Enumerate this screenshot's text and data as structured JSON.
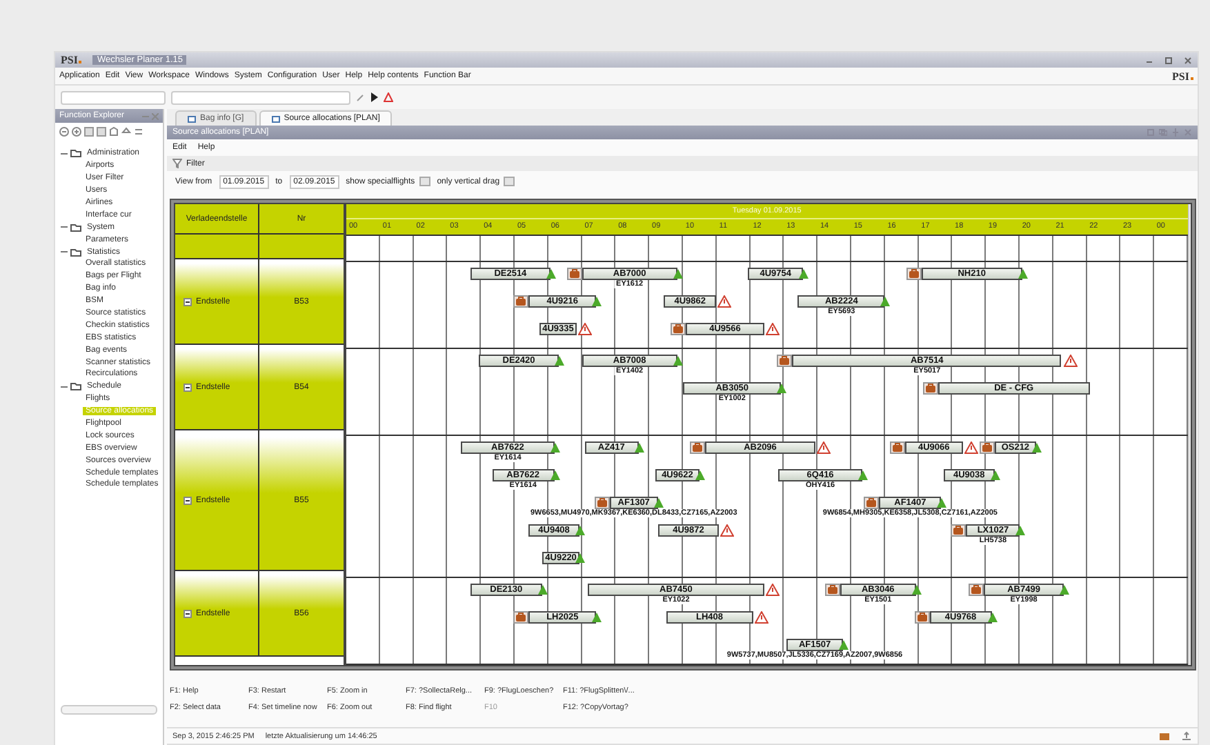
{
  "window": {
    "logo": "PSI",
    "title": "Wechsler Planer 1.15"
  },
  "menu": [
    "Application",
    "Edit",
    "View",
    "Workspace",
    "Windows",
    "System",
    "Configuration",
    "User",
    "Help",
    "Help contents",
    "Function Bar"
  ],
  "brand": "PSI",
  "explorer": {
    "title": "Function Explorer",
    "tree": [
      {
        "label": "Administration",
        "expanded": true,
        "selected": false,
        "children": [
          {
            "label": "Airports",
            "selected": false
          },
          {
            "label": "User Filter",
            "selected": false
          },
          {
            "label": "Users",
            "selected": false
          },
          {
            "label": "Airlines",
            "selected": false
          },
          {
            "label": "Interface cur",
            "selected": false
          }
        ]
      },
      {
        "label": "System",
        "expanded": true,
        "selected": false,
        "children": [
          {
            "label": "Parameters",
            "selected": false
          }
        ]
      },
      {
        "label": "Statistics",
        "expanded": true,
        "selected": false,
        "children": [
          {
            "label": "Overall statistics",
            "selected": false
          },
          {
            "label": "Bags per Flight",
            "selected": false
          },
          {
            "label": "Bag info",
            "selected": false
          },
          {
            "label": "BSM",
            "selected": false
          },
          {
            "label": "Source statistics",
            "selected": false
          },
          {
            "label": "Checkin statistics",
            "selected": false
          },
          {
            "label": "EBS statistics",
            "selected": false
          },
          {
            "label": "Bag events",
            "selected": false
          },
          {
            "label": "Scanner statistics",
            "selected": false
          },
          {
            "label": "Recirculations",
            "selected": false
          }
        ]
      },
      {
        "label": "Schedule",
        "expanded": true,
        "selected": false,
        "children": [
          {
            "label": "Flights",
            "selected": false
          },
          {
            "label": "Source allocations",
            "selected": true
          },
          {
            "label": "Flightpool",
            "selected": false
          },
          {
            "label": "Lock sources",
            "selected": false
          },
          {
            "label": "EBS overview",
            "selected": false
          },
          {
            "label": "Sources overview",
            "selected": false
          },
          {
            "label": "Schedule templates",
            "selected": false
          },
          {
            "label": "Schedule templates",
            "selected": false
          }
        ]
      }
    ]
  },
  "tabs": [
    {
      "label": "Bag info [G]",
      "selected": false
    },
    {
      "label": "Source allocations [PLAN]",
      "selected": true
    }
  ],
  "view": {
    "title": "Source allocations [PLAN]",
    "menu": [
      "Edit",
      "Help"
    ],
    "filter": "Filter",
    "range": {
      "from_label": "View from",
      "from": "01.09.2015",
      "to_label": "to",
      "to": "02.09.2015"
    },
    "options": [
      {
        "label": "show specialflights",
        "checked": false
      },
      {
        "label": "only vertical drag",
        "checked": false
      }
    ]
  },
  "gantt": {
    "columns": [
      "Verladeendstelle",
      "Nr"
    ],
    "date": "Tuesday 01.09.2015",
    "hours": [
      "00",
      "01",
      "02",
      "03",
      "04",
      "05",
      "06",
      "07",
      "08",
      "09",
      "10",
      "11",
      "12",
      "13",
      "14",
      "15",
      "16",
      "17",
      "18",
      "19",
      "20",
      "21",
      "22",
      "23",
      "00"
    ],
    "groups": [
      {
        "label": "Endstelle",
        "nr": "B53",
        "expanded": true,
        "lanes": [
          {
            "bars": [
              {
                "label": "DE2514",
                "bag": false,
                "confirmed": true,
                "warning": false
              },
              {
                "label": "AB7000",
                "bag": true,
                "confirmed": true,
                "warning": false,
                "note": "EY1612"
              },
              {
                "label": "4U9754",
                "bag": false,
                "confirmed": true,
                "warning": false
              },
              {
                "label": "NH210",
                "bag": true,
                "confirmed": true,
                "warning": false
              }
            ]
          },
          {
            "bars": [
              {
                "label": "4U9216",
                "bag": true,
                "confirmed": true,
                "warning": false
              },
              {
                "label": "4U9862",
                "bag": false,
                "confirmed": false,
                "warning": true
              },
              {
                "label": "AB2224",
                "bag": false,
                "confirmed": true,
                "warning": false,
                "note": "EY5693"
              }
            ]
          },
          {
            "bars": [
              {
                "label": "4U9335",
                "bag": false,
                "confirmed": false,
                "warning": true
              },
              {
                "label": "4U9566",
                "bag": true,
                "confirmed": false,
                "warning": true
              }
            ]
          }
        ]
      },
      {
        "label": "Endstelle",
        "nr": "B54",
        "expanded": true,
        "lanes": [
          {
            "bars": [
              {
                "label": "DE2420",
                "bag": false,
                "confirmed": true,
                "warning": false
              },
              {
                "label": "AB7008",
                "bag": false,
                "confirmed": true,
                "warning": false,
                "note": "EY1402"
              },
              {
                "label": "AB7514",
                "bag": true,
                "confirmed": false,
                "warning": true,
                "note": "EY5017"
              }
            ]
          },
          {
            "bars": [
              {
                "label": "AB3050",
                "bag": false,
                "confirmed": true,
                "warning": false,
                "note": "EY1002"
              },
              {
                "label": "DE - CFG",
                "bag": true,
                "confirmed": false,
                "warning": false
              }
            ]
          }
        ]
      },
      {
        "label": "Endstelle",
        "nr": "B55",
        "expanded": true,
        "lanes": [
          {
            "bars": [
              {
                "label": "AB7622",
                "bag": false,
                "confirmed": true,
                "warning": false,
                "note": "EY1614"
              },
              {
                "label": "AZ417",
                "bag": false,
                "confirmed": true,
                "warning": false
              },
              {
                "label": "AB2096",
                "bag": true,
                "confirmed": false,
                "warning": true
              },
              {
                "label": "4U9066",
                "bag": true,
                "confirmed": false,
                "warning": true
              },
              {
                "label": "OS212",
                "bag": true,
                "confirmed": true,
                "warning": false
              }
            ]
          },
          {
            "bars": [
              {
                "label": "AB7622",
                "bag": false,
                "confirmed": true,
                "warning": false,
                "note": "EY1614"
              },
              {
                "label": "4U9622",
                "bag": false,
                "confirmed": true,
                "warning": false
              },
              {
                "label": "6Q416",
                "bag": false,
                "confirmed": true,
                "warning": false,
                "note": "OHY416"
              },
              {
                "label": "4U9038",
                "bag": false,
                "confirmed": true,
                "warning": false
              }
            ]
          },
          {
            "bars": [
              {
                "label": "AF1307",
                "bag": true,
                "confirmed": true,
                "warning": false,
                "note": "9W6653,MU4970,MK9367,KE6360,DL8433,CZ7165,AZ2003"
              },
              {
                "label": "AF1407",
                "bag": true,
                "confirmed": true,
                "warning": false,
                "note": "9W6854,MH9305,KE6358,JL5308,CZ7161,AZ2005"
              }
            ]
          },
          {
            "bars": [
              {
                "label": "4U9408",
                "bag": false,
                "confirmed": true,
                "warning": false
              },
              {
                "label": "4U9872",
                "bag": false,
                "confirmed": false,
                "warning": true
              },
              {
                "label": "LX1027",
                "bag": true,
                "confirmed": true,
                "warning": false,
                "note": "LH5738"
              }
            ]
          },
          {
            "bars": [
              {
                "label": "4U9220",
                "bag": false,
                "confirmed": true,
                "warning": false
              }
            ]
          }
        ]
      },
      {
        "label": "Endstelle",
        "nr": "B56",
        "expanded": true,
        "lanes": [
          {
            "bars": [
              {
                "label": "DE2130",
                "bag": false,
                "confirmed": true,
                "warning": false
              },
              {
                "label": "AB7450",
                "bag": false,
                "confirmed": false,
                "warning": true,
                "note": "EY1022"
              },
              {
                "label": "AB3046",
                "bag": true,
                "confirmed": true,
                "warning": false,
                "note": "EY1501"
              },
              {
                "label": "AB7499",
                "bag": true,
                "confirmed": true,
                "warning": false,
                "note": "EY1998"
              }
            ]
          },
          {
            "bars": [
              {
                "label": "LH2025",
                "bag": true,
                "confirmed": true,
                "warning": false
              },
              {
                "label": "LH408",
                "bag": false,
                "confirmed": false,
                "warning": true
              },
              {
                "label": "4U9768",
                "bag": true,
                "confirmed": true,
                "warning": false
              }
            ]
          },
          {
            "bars": [
              {
                "label": "AF1507",
                "bag": false,
                "confirmed": true,
                "warning": false,
                "note": "9W5737,MU8507,JL5336,CZ7169,AZ2007,9W6856"
              }
            ]
          }
        ]
      }
    ]
  },
  "function_keys": [
    {
      "label": "F1: Help",
      "disabled": false
    },
    {
      "label": "F2: Select data",
      "disabled": false
    },
    {
      "label": "F3: Restart",
      "disabled": false
    },
    {
      "label": "F4: Set timeline now",
      "disabled": false
    },
    {
      "label": "F5: Zoom in",
      "disabled": false
    },
    {
      "label": "F6: Zoom out",
      "disabled": false
    },
    {
      "label": "F7: ?SollectaRelg...",
      "disabled": false
    },
    {
      "label": "F8: Find flight",
      "disabled": false
    },
    {
      "label": "F9: ?FlugLoeschen?",
      "disabled": false
    },
    {
      "label": "F10",
      "disabled": true
    },
    {
      "label": "F11: ?FlugSplitten\\/...",
      "disabled": false
    },
    {
      "label": "F12: ?CopyVortag?",
      "disabled": false
    }
  ],
  "status_bar": {
    "time": "Sep 3, 2015 2:46:25 PM",
    "message": "letzte Aktualisierung um 14:46:25"
  }
}
